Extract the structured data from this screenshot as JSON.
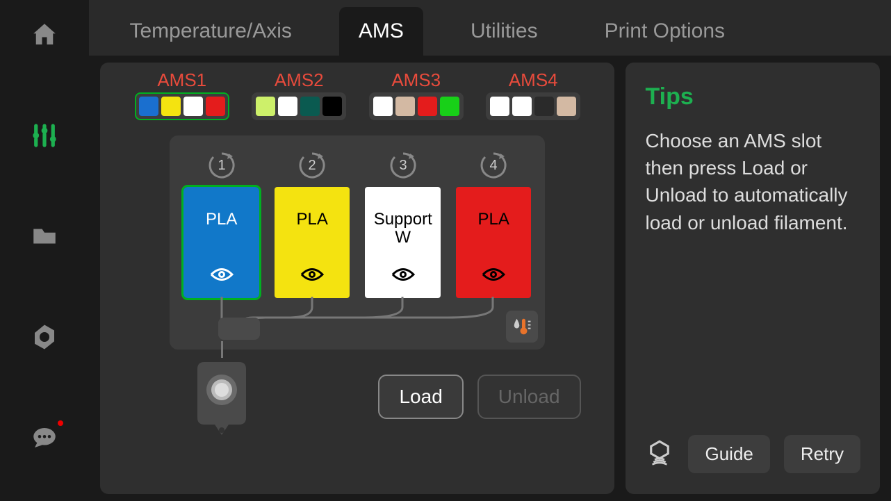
{
  "sidebar": {
    "items": [
      {
        "name": "home-icon"
      },
      {
        "name": "settings-icon"
      },
      {
        "name": "files-icon"
      },
      {
        "name": "maintenance-icon"
      },
      {
        "name": "chat-icon"
      }
    ]
  },
  "tabs": [
    {
      "label": "Temperature/Axis",
      "active": false
    },
    {
      "label": "AMS",
      "active": true
    },
    {
      "label": "Utilities",
      "active": false
    },
    {
      "label": "Print Options",
      "active": false
    }
  ],
  "ams": {
    "units": [
      {
        "label": "AMS1",
        "active": true,
        "colors": [
          "#1a6fcf",
          "#f4e310",
          "#ffffff",
          "#e41c1c"
        ]
      },
      {
        "label": "AMS2",
        "active": false,
        "colors": [
          "#cdf06a",
          "#ffffff",
          "#0a5a50",
          "#000000"
        ]
      },
      {
        "label": "AMS3",
        "active": false,
        "colors": [
          "#ffffff",
          "#d3b9a3",
          "#e41c1c",
          "#18d018"
        ]
      },
      {
        "label": "AMS4",
        "active": false,
        "colors": [
          "#ffffff",
          "#ffffff",
          "#2a2a2a",
          "#d3b9a3"
        ]
      }
    ],
    "slots": [
      {
        "num": "1",
        "label": "PLA",
        "bg": "#1178c9",
        "fg": "#ffffff",
        "selected": true
      },
      {
        "num": "2",
        "label": "PLA",
        "bg": "#f4e310",
        "fg": "#000000",
        "selected": false
      },
      {
        "num": "3",
        "label": "Support W",
        "bg": "#ffffff",
        "fg": "#000000",
        "selected": false
      },
      {
        "num": "4",
        "label": "PLA",
        "bg": "#e41c1c",
        "fg": "#000000",
        "selected": false
      }
    ],
    "buttons": {
      "load": "Load",
      "unload": "Unload"
    }
  },
  "tips": {
    "title": "Tips",
    "body": "Choose an AMS slot then press Load or Unload to automatically load or unload filament."
  },
  "footer": {
    "guide": "Guide",
    "retry": "Retry"
  }
}
